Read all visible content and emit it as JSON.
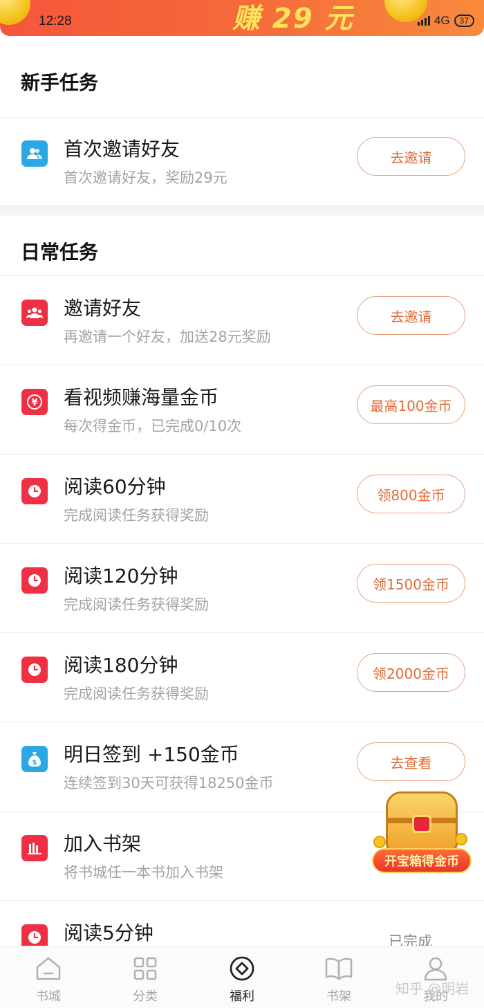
{
  "status_bar": {
    "time": "12:28",
    "network": "4G",
    "battery": "37"
  },
  "banner": {
    "text": "赚 29 元"
  },
  "newbie_section": {
    "title": "新手任务",
    "tasks": [
      {
        "title": "首次邀请好友",
        "desc": "首次邀请好友，奖励29元",
        "button": "去邀请",
        "icon": "user-group-icon",
        "color": "#2aa8e4"
      }
    ]
  },
  "daily_section": {
    "title": "日常任务",
    "tasks": [
      {
        "title": "邀请好友",
        "desc": "再邀请一个好友，加送28元奖励",
        "button": "去邀请",
        "icon": "users-icon",
        "color": "#ef2f43"
      },
      {
        "title": "看视频赚海量金币",
        "desc": "每次得金币，已完成0/10次",
        "button": "最高100金币",
        "icon": "yuan-coin-icon",
        "color": "#ef2f43"
      },
      {
        "title": "阅读60分钟",
        "desc": "完成阅读任务获得奖励",
        "button": "领800金币",
        "icon": "clock-icon",
        "color": "#ef2f43"
      },
      {
        "title": "阅读120分钟",
        "desc": "完成阅读任务获得奖励",
        "button": "领1500金币",
        "icon": "clock-icon",
        "color": "#ef2f43"
      },
      {
        "title": "阅读180分钟",
        "desc": "完成阅读任务获得奖励",
        "button": "领2000金币",
        "icon": "clock-icon",
        "color": "#ef2f43"
      },
      {
        "title": "明日签到 +150金币",
        "desc": "连续签到30天可获得18250金币",
        "button": "去查看",
        "icon": "money-bag-icon",
        "color": "#2aa8e4"
      },
      {
        "title": "加入书架",
        "desc": "将书城任一本书加入书架",
        "button": "",
        "icon": "bookshelf-icon",
        "color": "#ef2f43"
      },
      {
        "title": "阅读5分钟",
        "desc": "",
        "button": "",
        "icon": "clock-icon",
        "color": "#ef2f43"
      }
    ],
    "completed_label": "已完成"
  },
  "treasure_chest": {
    "label": "开宝箱得金币"
  },
  "bottom_nav": {
    "items": [
      {
        "label": "书城",
        "icon": "home-icon"
      },
      {
        "label": "分类",
        "icon": "category-grid-icon"
      },
      {
        "label": "福利",
        "icon": "welfare-coin-icon",
        "active": true
      },
      {
        "label": "书架",
        "icon": "book-icon"
      },
      {
        "label": "我的",
        "icon": "profile-icon"
      }
    ]
  },
  "watermark": "知乎 @明岩",
  "colors": {
    "accent": "#e46a34",
    "blue_icon": "#2aa8e4",
    "red_icon": "#ef2f43"
  }
}
